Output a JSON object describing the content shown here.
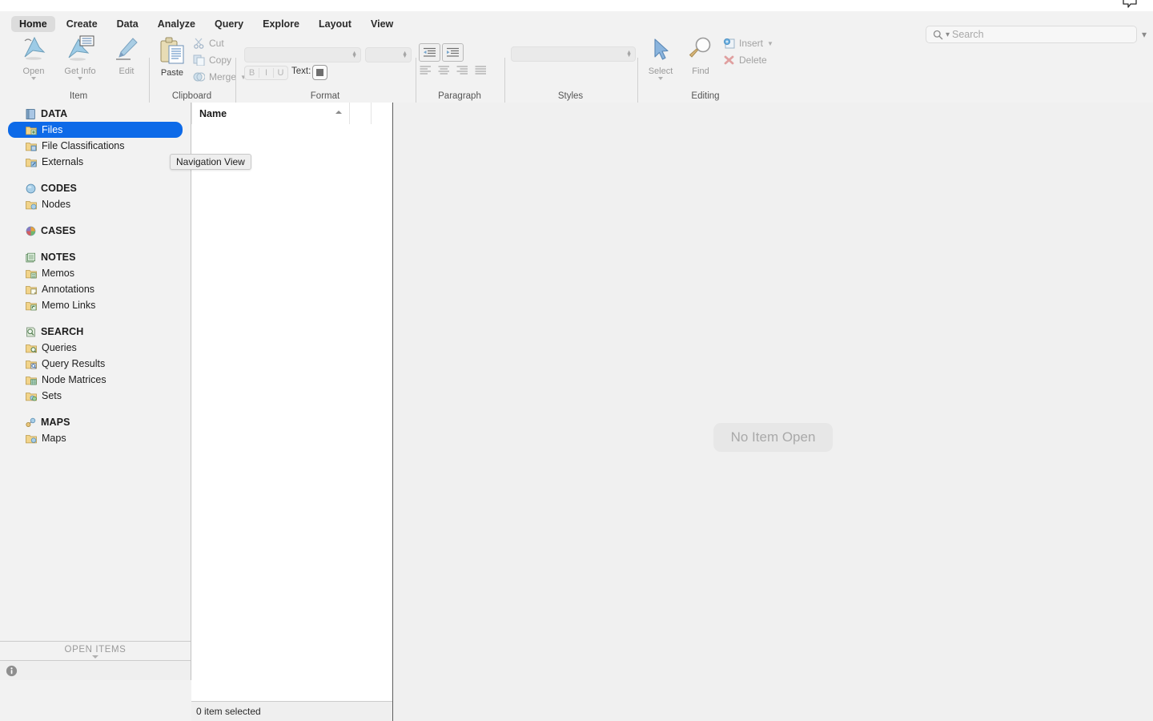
{
  "window": {
    "titlebar_icon": "message-bubble-icon"
  },
  "ribbon": {
    "tabs": [
      {
        "label": "Home",
        "active": true
      },
      {
        "label": "Create",
        "active": false
      },
      {
        "label": "Data",
        "active": false
      },
      {
        "label": "Analyze",
        "active": false
      },
      {
        "label": "Query",
        "active": false
      },
      {
        "label": "Explore",
        "active": false
      },
      {
        "label": "Layout",
        "active": false
      },
      {
        "label": "View",
        "active": false
      }
    ],
    "search": {
      "placeholder": "Search",
      "value": "",
      "icon": "search-icon",
      "disclosure_icon": "chevron-down-icon"
    },
    "groups": [
      {
        "name": "item",
        "label": "Item",
        "buttons": [
          {
            "label": "Open",
            "icon": "open-item-icon",
            "enabled": false,
            "has_menu": true
          },
          {
            "label": "Get Info",
            "icon": "get-info-icon",
            "enabled": false,
            "has_menu": true
          },
          {
            "label": "Edit",
            "icon": "edit-pencil-icon",
            "enabled": false,
            "has_menu": false
          }
        ]
      },
      {
        "name": "clipboard",
        "label": "Clipboard",
        "paste": {
          "label": "Paste",
          "icon": "paste-clipboard-icon",
          "enabled": true
        },
        "items": [
          {
            "label": "Cut",
            "icon": "cut-scissors-icon",
            "enabled": false,
            "has_menu": false
          },
          {
            "label": "Copy",
            "icon": "copy-icon",
            "enabled": false,
            "has_menu": false
          },
          {
            "label": "Merge",
            "icon": "merge-icon",
            "enabled": false,
            "has_menu": true
          }
        ]
      },
      {
        "name": "format",
        "label": "Format",
        "font_family": {
          "value": "",
          "icon": "stepper-icon"
        },
        "font_size": {
          "value": "",
          "icon": "stepper-icon"
        },
        "style_buttons": [
          "B",
          "I",
          "U"
        ],
        "text_color_label": "Text:",
        "text_color": "#6e6e6e"
      },
      {
        "name": "paragraph",
        "label": "Paragraph",
        "indent_buttons": [
          {
            "icon": "decrease-indent-icon"
          },
          {
            "icon": "increase-indent-icon"
          }
        ],
        "align_buttons": [
          {
            "icon": "align-left-icon"
          },
          {
            "icon": "align-center-icon"
          },
          {
            "icon": "align-right-icon"
          },
          {
            "icon": "align-justify-icon"
          }
        ]
      },
      {
        "name": "styles",
        "label": "Styles",
        "style_select": {
          "value": "",
          "icon": "stepper-icon"
        }
      },
      {
        "name": "editing",
        "label": "Editing",
        "buttons": [
          {
            "label": "Select",
            "icon": "select-cursor-icon",
            "enabled": false,
            "has_menu": true
          },
          {
            "label": "Find",
            "icon": "find-magnifier-icon",
            "enabled": false,
            "has_menu": false
          }
        ],
        "items": [
          {
            "label": "Insert",
            "icon": "insert-icon",
            "enabled": false,
            "has_menu": true
          },
          {
            "label": "Delete",
            "icon": "delete-x-icon",
            "enabled": false,
            "has_menu": false
          }
        ]
      }
    ]
  },
  "sidebar": {
    "sections": [
      {
        "label": "DATA",
        "icon": "data-book-icon",
        "items": [
          {
            "label": "Files",
            "icon": "files-folder-icon",
            "selected": true
          },
          {
            "label": "File Classifications",
            "icon": "file-classifications-folder-icon",
            "selected": false
          },
          {
            "label": "Externals",
            "icon": "externals-folder-icon",
            "selected": false
          }
        ]
      },
      {
        "label": "CODES",
        "icon": "codes-sphere-icon",
        "items": [
          {
            "label": "Nodes",
            "icon": "nodes-folder-icon",
            "selected": false
          }
        ]
      },
      {
        "label": "CASES",
        "icon": "cases-pie-icon",
        "items": []
      },
      {
        "label": "NOTES",
        "icon": "notes-stack-icon",
        "items": [
          {
            "label": "Memos",
            "icon": "memos-folder-icon",
            "selected": false
          },
          {
            "label": "Annotations",
            "icon": "annotations-folder-icon",
            "selected": false
          },
          {
            "label": "Memo Links",
            "icon": "memo-links-folder-icon",
            "selected": false
          }
        ]
      },
      {
        "label": "SEARCH",
        "icon": "search-magnifier-icon",
        "items": [
          {
            "label": "Queries",
            "icon": "queries-folder-icon",
            "selected": false
          },
          {
            "label": "Query Results",
            "icon": "query-results-folder-icon",
            "selected": false
          },
          {
            "label": "Node Matrices",
            "icon": "node-matrices-folder-icon",
            "selected": false
          },
          {
            "label": "Sets",
            "icon": "sets-folder-icon",
            "selected": false
          }
        ]
      },
      {
        "label": "MAPS",
        "icon": "maps-icon",
        "items": [
          {
            "label": "Maps",
            "icon": "maps-folder-icon",
            "selected": false
          }
        ]
      }
    ],
    "open_items": {
      "label": "OPEN ITEMS",
      "disclosure_icon": "triangle-down-icon"
    },
    "status_icon": "info-icon"
  },
  "list_pane": {
    "columns": [
      {
        "label": "Name",
        "sort": "asc",
        "sort_icon": "sort-ascending-icon"
      }
    ],
    "rows": [],
    "status": "0 item selected"
  },
  "detail_pane": {
    "empty_message": "No Item Open"
  },
  "tooltip": {
    "text": "Navigation View"
  },
  "colors": {
    "selection_blue": "#0d6ae8",
    "ribbon_bg": "#f2f2f2",
    "pane_bg": "#ffffff",
    "detail_bg": "#f0f0f0",
    "disabled_text": "#a2a2a2"
  }
}
